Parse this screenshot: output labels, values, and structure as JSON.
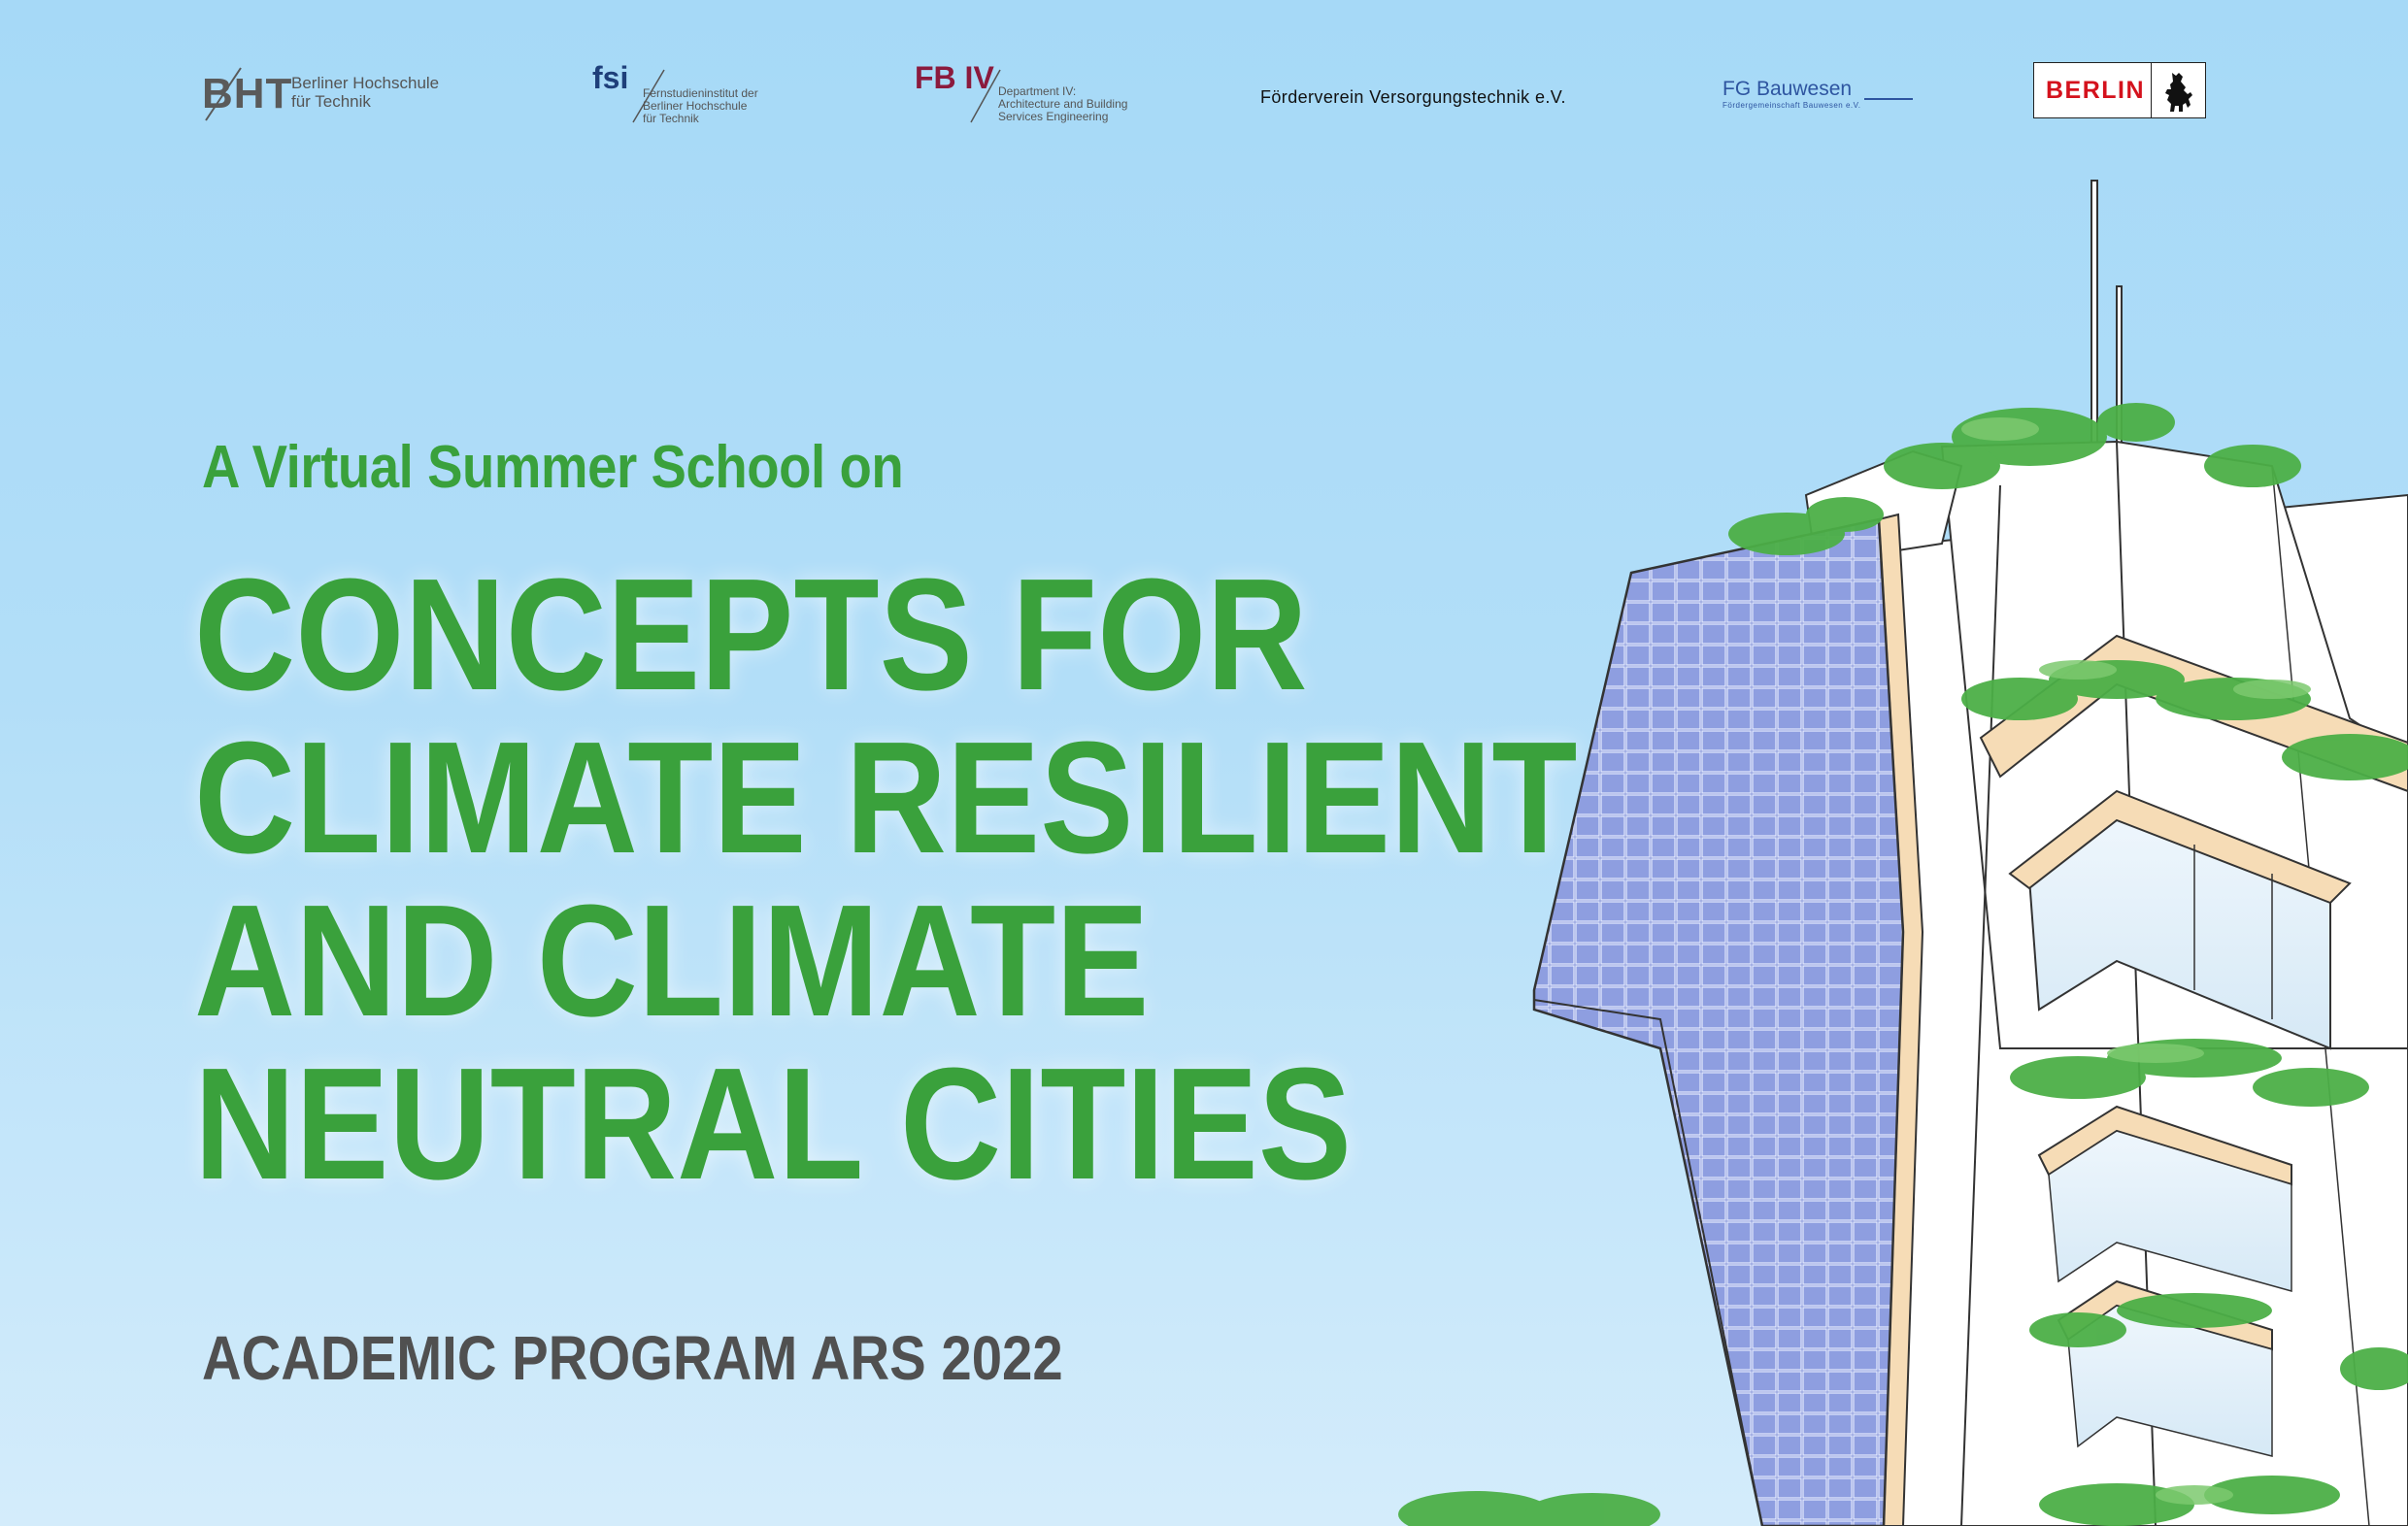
{
  "logos": {
    "bht": {
      "mark": "BHT",
      "line1": "Berliner Hochschule",
      "line2": "für Technik"
    },
    "fsi": {
      "mark": "fsi",
      "line1": "Fernstudieninstitut der",
      "line2": "Berliner Hochschule",
      "line3": "für Technik",
      "color": "#1e3f7a"
    },
    "fb4": {
      "mark": "FB IV",
      "line1": "Department IV:",
      "line2": "Architecture and Building",
      "line3": "Services Engineering",
      "color": "#8b1a3d"
    },
    "foerderverein": {
      "text": "Förderverein Versorgungstechnik e.V."
    },
    "fg_bauwesen": {
      "main": "FG Bauwesen",
      "sub": "Fördergemeinschaft Bauwesen e.V.",
      "color": "#2e55a0"
    },
    "berlin": {
      "word": "BERLIN",
      "color": "#d4121d"
    }
  },
  "headline": {
    "subtitle": "A Virtual Summer School on",
    "title_lines": [
      "CONCEPTS FOR",
      "CLIMATE RESILIENT",
      "AND CLIMATE",
      "NEUTRAL CITIES"
    ],
    "program": "ACADEMIC PROGRAM ARS 2022"
  },
  "colors": {
    "accent_green": "#3aa13c",
    "program_grey": "#505050",
    "sky_top": "#a6d9f7",
    "solar_panel": "#7f8fd6"
  },
  "illustration": {
    "icon": "green-building-illustration"
  }
}
